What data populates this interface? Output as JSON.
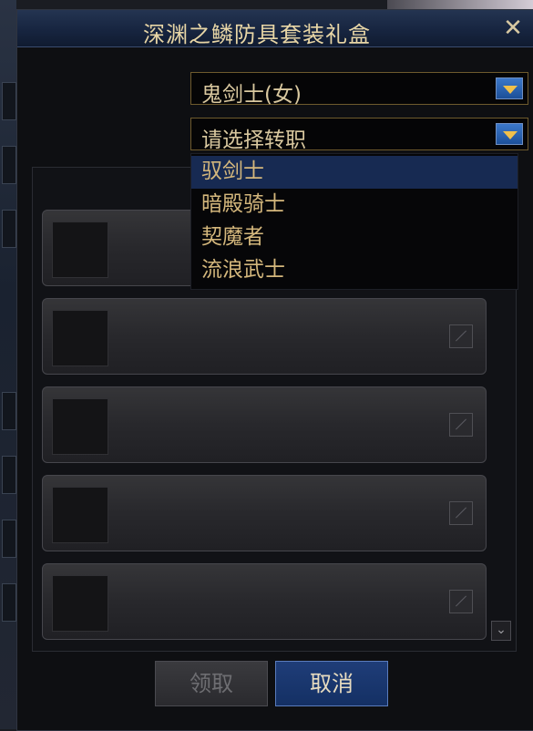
{
  "window": {
    "title": "深渊之鳞防具套装礼盒",
    "close_label": "✕"
  },
  "character_select": {
    "value": "鬼剑士(女)"
  },
  "class_select": {
    "value": "请选择转职",
    "options": [
      "驭剑士",
      "暗殿骑士",
      "契魔者",
      "流浪武士"
    ],
    "selected_index": 0
  },
  "item_slots": [
    {
      "checked": false
    },
    {
      "checked": false
    },
    {
      "checked": false
    },
    {
      "checked": false
    },
    {
      "checked": false
    }
  ],
  "buttons": {
    "claim_label": "领取",
    "claim_enabled": false,
    "cancel_label": "取消"
  },
  "colors": {
    "title_text": "#e8d6a6",
    "dropdown_text": "#d9c89f",
    "highlight": "#172a52",
    "cancel_button": "#1f3d78"
  }
}
